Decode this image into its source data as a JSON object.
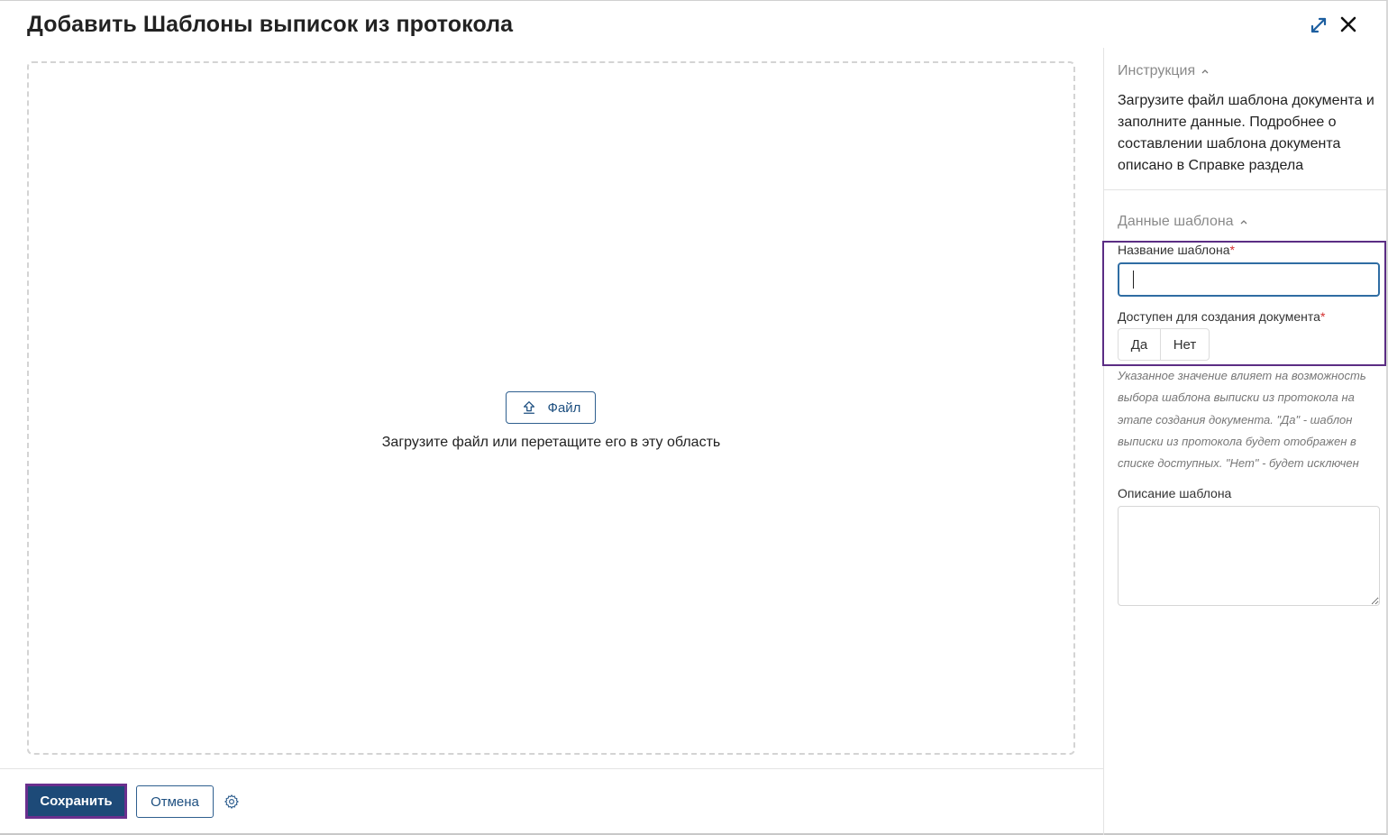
{
  "dialog": {
    "title": "Добавить Шаблоны выписок из протокола"
  },
  "dropzone": {
    "file_button_label": "Файл",
    "hint": "Загрузите файл или перетащите его в эту область"
  },
  "sidebar": {
    "instruction": {
      "heading": "Инструкция",
      "text": "Загрузите файл шаблона документа и заполните данные. Подробнее о составлении шаблона документа описано в Справке раздела"
    },
    "template_data": {
      "heading": "Данные шаблона",
      "name_label": "Название шаблона",
      "name_value": "",
      "required_mark": "*",
      "available_label": "Доступен для создания документа",
      "available_options": [
        "Да",
        "Нет"
      ],
      "available_hint": "Указанное значение влияет на возможность выбора шаблона выписки из протокола на этапе создания документа. \"Да\" - шаблон выписки из протокола будет отображен в списке доступных. \"Нет\" - будет исключен",
      "description_label": "Описание шаблона",
      "description_value": ""
    }
  },
  "footer": {
    "save_label": "Сохранить",
    "cancel_label": "Отмена"
  },
  "icons": {
    "expand": "expand-icon",
    "close": "close-icon",
    "upload": "upload-icon",
    "chevron": "chevron-up-icon",
    "settings": "gear-icon"
  },
  "colors": {
    "primary": "#1d4a78",
    "accent_border": "#2f6da3",
    "highlight": "#5b2d84",
    "required": "#d32f2f"
  }
}
